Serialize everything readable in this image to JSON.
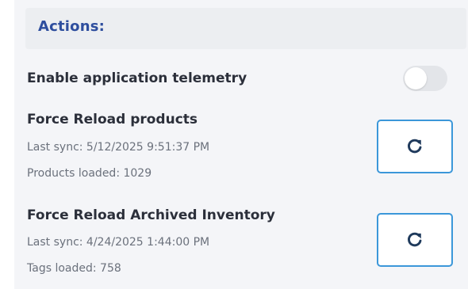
{
  "actions": {
    "title": "Actions:",
    "telemetry": {
      "label": "Enable application telemetry",
      "enabled": false
    },
    "products": {
      "label": "Force Reload products",
      "last_sync": "Last sync: 5/12/2025 9:51:37 PM",
      "loaded": "Products loaded: 1029",
      "button_icon": "refresh-icon"
    },
    "archived_inventory": {
      "label": "Force Reload Archived Inventory",
      "last_sync": "Last sync: 4/24/2025 1:44:00 PM",
      "loaded": "Tags loaded: 758",
      "button_icon": "refresh-icon"
    }
  },
  "colors": {
    "title": "#2e4e9e",
    "button_border": "#3b97d9",
    "icon": "#1f3a5c",
    "toggle_track": "#e3e5e9"
  }
}
